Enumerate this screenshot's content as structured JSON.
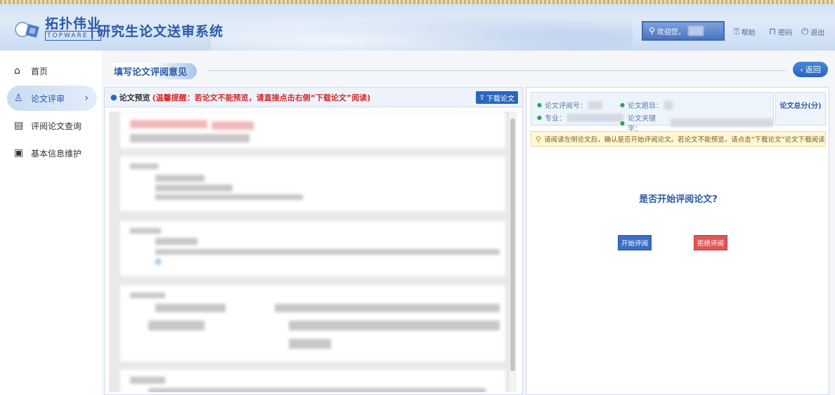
{
  "header": {
    "logo_cn": "拓扑伟业",
    "logo_en": "TOPWARE",
    "system_title": "研究生论文送审系统",
    "welcome": "欢迎您，",
    "help": "帮助",
    "password": "密码",
    "logout": "退出"
  },
  "sidebar": {
    "items": [
      {
        "label": "首页",
        "icon": "home-icon"
      },
      {
        "label": "论文评审",
        "icon": "review-icon"
      },
      {
        "label": "评阅论文查询",
        "icon": "query-icon"
      },
      {
        "label": "基本信息维护",
        "icon": "info-icon"
      }
    ]
  },
  "main": {
    "page_title": "填写论文评阅意见",
    "back_label": "返回",
    "preview": {
      "label": "论文预览",
      "tip": "(温馨提醒：若论文不能预览，请直接点击右侧“下载论文”阅读)",
      "download_label": "下载论文"
    },
    "review": {
      "review_no_label": "论文评阅号：",
      "title_label": "论文题目：",
      "major_label": "专业：",
      "keywords_label": "论文关键字：",
      "total_score_label": "论文总分(分)",
      "notice": "请阅读左侧论文后，确认是否开始评阅论文。若论文不能预览，请点击“下载论文”论文下载阅读。",
      "question": "是否开始评阅论文?",
      "start_label": "开始评阅",
      "reject_label": "拒绝评阅"
    }
  },
  "colors": {
    "accent": "#2a5aa8",
    "button_blue": "#3a6ec4",
    "button_red": "#e05555",
    "tip_red": "#d42a2a"
  }
}
